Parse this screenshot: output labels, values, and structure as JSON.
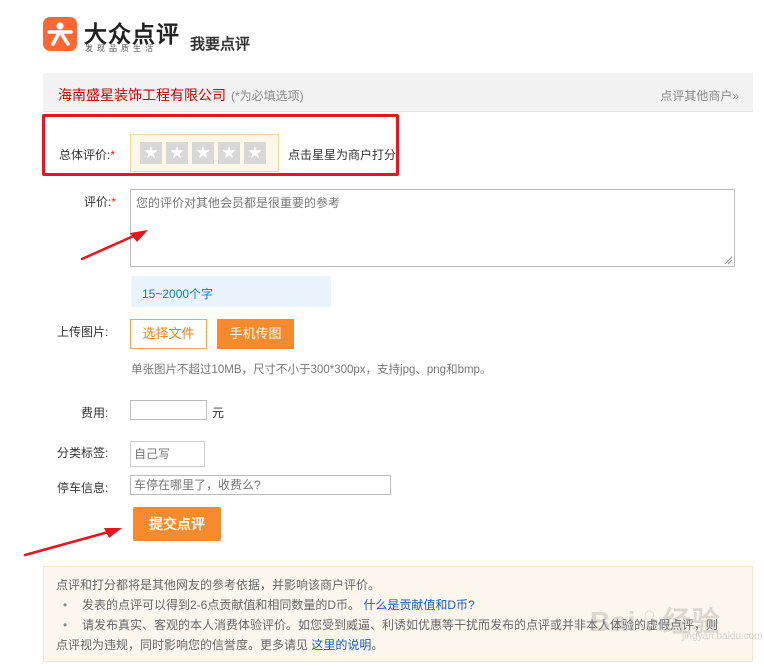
{
  "brand": {
    "name": "大众点评",
    "slogan": "发现品质生活",
    "color": "#ff6633"
  },
  "page_title": "我要点评",
  "header": {
    "shop_name": "海南盛星装饰工程有限公司",
    "required_note": "(*为必填选项)",
    "other_shops_link": "点评其他商户»"
  },
  "rating": {
    "label": "总体评价:",
    "required_mark": "*",
    "star_count": 5,
    "stars_selected": 0,
    "hint": "点击星星为商户打分"
  },
  "comment": {
    "label": "评价:",
    "required_mark": "*",
    "placeholder": "您的评价对其他会员都是很重要的参考",
    "char_limit": "15~2000个字"
  },
  "upload": {
    "label": "上传图片:",
    "choose_file": "选择文件",
    "phone_upload": "手机传图",
    "note": "单张图片不超过10MB，尺寸不小于300*300px，支持jpg、png和bmp。"
  },
  "fee": {
    "label": "费用:",
    "unit": "元",
    "value": ""
  },
  "tags": {
    "label": "分类标签:",
    "placeholder": "自己写"
  },
  "parking": {
    "label": "停车信息:",
    "placeholder": "车停在哪里了，收费么?"
  },
  "submit": {
    "label": "提交点评"
  },
  "notice": {
    "line1": "点评和打分都将是其他网友的参考依据，并影响该商户评价。",
    "bullet": "•",
    "line2_text": "发表的点评可以得到2-6点贡献值和相同数量的D币。",
    "line2_link": "什么是贡献值和D币?",
    "line3_text": "请发布真实、客观的本人消费体验评价。如您受到威逼、利诱如优惠等干扰而发布的点评或并非本人体验的虚假点评，则",
    "line4_text": "点评视为违规，同时影响您的信誉度。更多请见",
    "line4_link": "这里的说明",
    "line4_end": "。"
  },
  "watermark": {
    "text": "Bai♧经验",
    "sub": "jingyan.baidu.com"
  },
  "colors": {
    "accent": "#f78a2d",
    "highlight": "#e8151d",
    "link": "#1a5bb8",
    "shop_name": "#cc0000"
  }
}
